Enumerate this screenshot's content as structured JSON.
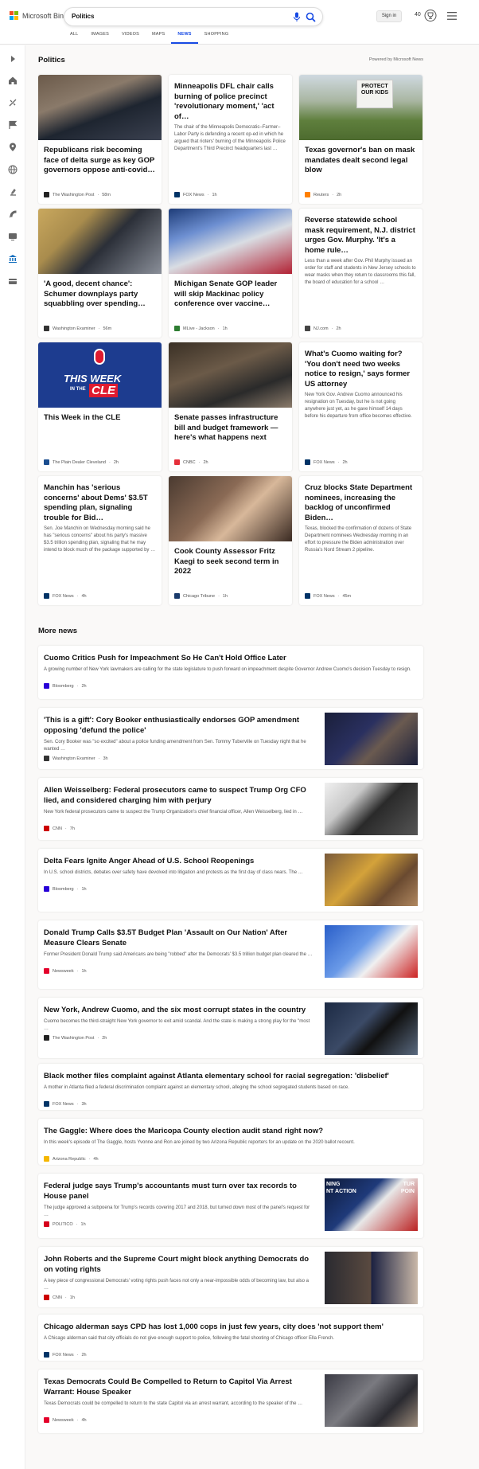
{
  "header": {
    "brand": "Microsoft Bing",
    "query": "Politics",
    "signin": "Sign in",
    "points": "40",
    "colors": {
      "accent": "#174ae4"
    }
  },
  "tabs": [
    "ALL",
    "IMAGES",
    "VIDEOS",
    "MAPS",
    "NEWS",
    "SHOPPING"
  ],
  "active_tab": "NEWS",
  "sidebar_icons": [
    "chevron-right-icon",
    "home-icon",
    "scale-icon",
    "flag-icon",
    "location-pin-icon",
    "globe-icon",
    "microscope-icon",
    "rocket-icon",
    "tv-icon",
    "government-icon",
    "wallet-icon"
  ],
  "section": {
    "title": "Politics",
    "powered": "Powered by Microsoft News"
  },
  "cards": [
    {
      "title": "Republicans risk becoming face of delta surge as key GOP governors oppose anti-covid…",
      "source": "The Washington Post",
      "time": "58m"
    },
    {
      "title": "Minneapolis DFL chair calls burning of police precinct 'revolutionary moment,' 'act of…",
      "snippet": "The chair of the Minneapolis Democratic–Farmer–Labor Party is defending a recent op-ed in which he argued that rioters' burning of the Minneapolis Police Department's Third Precinct headquarters last …",
      "source": "FOX News",
      "time": "1h"
    },
    {
      "title": "Texas governor's ban on mask mandates dealt second legal blow",
      "source": "Reuters",
      "time": "2h",
      "sign_text": "PROTECT OUR KIDS"
    },
    {
      "title": "'A good, decent chance': Schumer downplays party squabbling over spending…",
      "source": "Washington Examiner",
      "time": "56m"
    },
    {
      "title": "Michigan Senate GOP leader will skip Mackinac policy conference over vaccine…",
      "source": "MLive - Jackson",
      "time": "1h"
    },
    {
      "title": "Reverse statewide school mask requirement, N.J. district urges Gov. Murphy. 'It's a home rule…",
      "snippet": "Less than a week after Gov. Phil Murphy issued an order for staff and students in New Jersey schools to wear masks when they return to classrooms this fall, the board of education for a school …",
      "source": "NJ.com",
      "time": "2h"
    },
    {
      "title": "This Week in the CLE",
      "source": "The Plain Dealer Cleveland",
      "time": "2h",
      "logo_text": [
        "THIS WEEK",
        "IN THE",
        "CLE"
      ]
    },
    {
      "title": "Senate passes infrastructure bill and budget framework — here's what happens next",
      "source": "CNBC",
      "time": "2h"
    },
    {
      "title": "What's Cuomo waiting for? 'You don't need two weeks notice to resign,' says former US attorney",
      "snippet": "New York Gov. Andrew Cuomo announced his resignation on Tuesday, but he is not going anywhere just yet, as he gave himself 14 days before his departure from office becomes effective.",
      "source": "FOX News",
      "time": "2h"
    },
    {
      "title": "Manchin has 'serious concerns' about Dems' $3.5T spending plan, signaling trouble for Bid…",
      "snippet": "Sen. Joe Manchin on Wednesday morning said he has \"serious concerns\" about his party's massive $3.5 trillion spending plan, signaling that he may intend to block much of the package supported by …",
      "source": "FOX News",
      "time": "4h"
    },
    {
      "title": "Cook County Assessor Fritz Kaegi to seek second term in 2022",
      "source": "Chicago Tribune",
      "time": "1h"
    },
    {
      "title": "Cruz blocks State Department nominees, increasing the backlog of unconfirmed Biden…",
      "snippet": "Texas, blocked the confirmation of dozens of State Department nominees Wednesday morning in an effort to pressure the Biden administration over Russia's Nord Stream 2 pipeline.",
      "source": "FOX News",
      "time": "45m"
    }
  ],
  "more_news_title": "More news",
  "rows": [
    {
      "title": "Cuomo Critics Push for Impeachment So He Can't Hold Office Later",
      "snippet": "A growing number of New York lawmakers are calling for the state legislature to push forward on impeachment despite Governor Andrew Cuomo's decision Tuesday to resign.",
      "source": "Bloomberg",
      "time": "2h"
    },
    {
      "title": "'This is a gift': Cory Booker enthusiastically endorses GOP amendment opposing 'defund the police'",
      "snippet": "Sen. Cory Booker was \"so excited\" about a police funding amendment from Sen. Tommy Tuberville on Tuesday night that he wanted …",
      "source": "Washington Examiner",
      "time": "3h"
    },
    {
      "title": "Allen Weisselberg: Federal prosecutors came to suspect Trump Org CFO lied, and considered charging him with perjury",
      "snippet": "New York federal prosecutors came to suspect the Trump Organization's chief financial officer, Allen Weisselberg, lied in …",
      "source": "CNN",
      "time": "7h"
    },
    {
      "title": "Delta Fears Ignite Anger Ahead of U.S. School Reopenings",
      "snippet": "In U.S. school districts, debates over safety have devolved into litigation and protests as the first day of class nears. The …",
      "source": "Bloomberg",
      "time": "1h"
    },
    {
      "title": "Donald Trump Calls $3.5T Budget Plan 'Assault on Our Nation' After Measure Clears Senate",
      "snippet": "Former President Donald Trump said Americans are being \"robbed\" after the Democrats' $3.5 trillion budget plan cleared the …",
      "source": "Newsweek",
      "time": "1h"
    },
    {
      "title": "New York, Andrew Cuomo, and the six most corrupt states in the country",
      "snippet": "Cuomo becomes the third-straight New York governor to exit amid scandal. And the state is making a strong play for the \"most …",
      "source": "The Washington Post",
      "time": "2h"
    },
    {
      "title": "Black mother files complaint against Atlanta elementary school for racial segregation: 'disbelief'",
      "snippet": "A mother in Atlanta filed a federal discrimination complaint against an elementary school, alleging the school segregated students based on race.",
      "source": "FOX News",
      "time": "3h"
    },
    {
      "title": "The Gaggle: Where does the Maricopa County election audit stand right now?",
      "snippet": "In this week's episode of The Gaggle, hosts Yvonne and Ron are joined by two Arizona Republic reporters for an update on the 2020 ballot recount.",
      "source": "Arizona Republic",
      "time": "4h"
    },
    {
      "title": "Federal judge says Trump's accountants must turn over tax records to House panel",
      "snippet": "The judge approved a subpoena for Trump's records covering 2017 and 2018, but turned down most of the panel's request for …",
      "source": "POLITICO",
      "time": "1h",
      "banner_text": [
        "NING",
        "NT ACTION",
        "TUR",
        "POIN"
      ]
    },
    {
      "title": "John Roberts and the Supreme Court might block anything Democrats do on voting rights",
      "snippet": "A key piece of congressional Democrats' voting rights push faces not only a near-impossible odds of becoming law, but also a …",
      "source": "CNN",
      "time": "1h"
    },
    {
      "title": "Chicago alderman says CPD has lost 1,000 cops in just few years, city does 'not support them'",
      "snippet": "A Chicago alderman said that city officials do not give enough support to police, following the fatal shooting of Chicago officer Ella French.",
      "source": "FOX News",
      "time": "2h"
    },
    {
      "title": "Texas Democrats Could Be Compelled to Return to Capitol Via Arrest Warrant: House Speaker",
      "snippet": "Texas Democrats could be compelled to return to the state Capitol via an arrest warrant, according to the speaker of the …",
      "source": "Newsweek",
      "time": "4h"
    }
  ]
}
